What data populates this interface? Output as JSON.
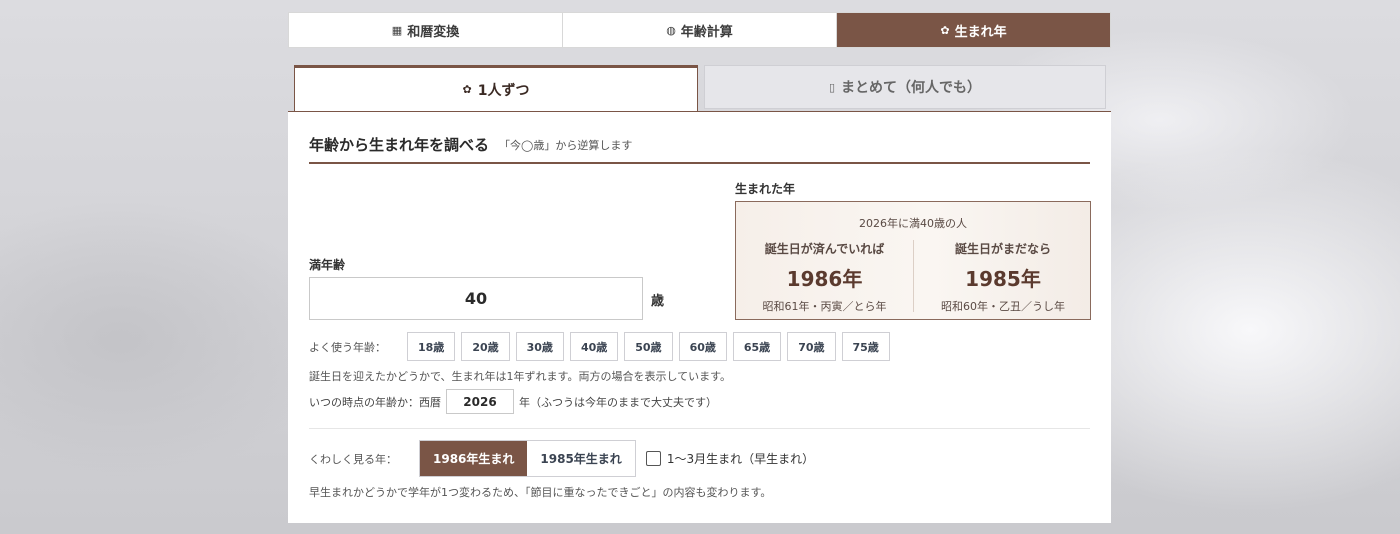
{
  "topnav": {
    "items": [
      {
        "icon": "▦",
        "label": "和暦変換"
      },
      {
        "icon": "◍",
        "label": "年齢計算"
      },
      {
        "icon": "✿",
        "label": "生まれ年"
      }
    ]
  },
  "subtabs": {
    "single": {
      "icon": "✿",
      "label": "1人ずつ"
    },
    "bulk": {
      "icon": "▯",
      "label": "まとめて（何人でも）"
    }
  },
  "panel": {
    "heading": "年齢から生まれ年を調べる",
    "subheading": "「今◯歳」から逆算します",
    "age_label": "満年齢",
    "age_value": "40",
    "age_unit": "歳",
    "result_label": "生まれた年",
    "result": {
      "title": "2026年に満40歳の人",
      "after": {
        "cond": "誕生日が済んでいれば",
        "year": "1986年",
        "era": "昭和61年・丙寅／とら年"
      },
      "before": {
        "cond": "誕生日がまだなら",
        "year": "1985年",
        "era": "昭和60年・乙丑／うし年"
      }
    },
    "quick_label": "よく使う年齢：",
    "quick_ages": [
      "18歳",
      "20歳",
      "30歳",
      "40歳",
      "50歳",
      "60歳",
      "65歳",
      "70歳",
      "75歳"
    ],
    "note1": "誕生日を迎えたかどうかで、生まれ年は1年ずれます。両方の場合を表示しています。",
    "basis_label": "いつの時点の年齢か：西暦",
    "basis_year": "2026",
    "basis_suffix": "年（ふつうは今年のままで大丈夫です）",
    "detail_label": "くわしく見る年：",
    "detail_options": [
      "1986年生まれ",
      "1985年生まれ"
    ],
    "early_label": "1〜3月生まれ（早生まれ）",
    "note2": "早生まれかどうかで学年が1つ変わるため、「節目に重なったできごと」の内容も変わります。"
  },
  "colors": {
    "accent": "#7a5546",
    "result_bg": "#f6efe9"
  },
  "icons": {
    "calendar": "calendar-icon",
    "age": "face-icon",
    "birth": "flower-icon",
    "clipboard": "clipboard-icon"
  }
}
